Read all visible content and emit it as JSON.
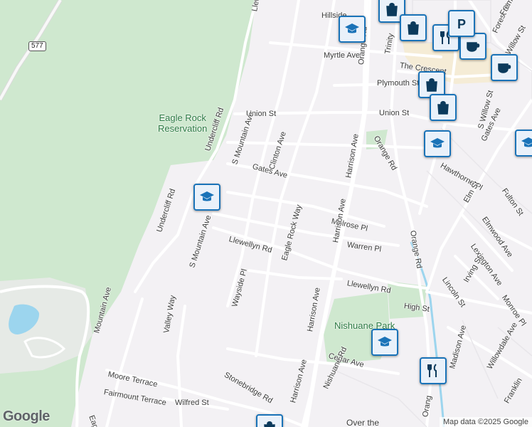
{
  "map": {
    "parks": [
      {
        "name": "Eagle Rock\nReservation"
      },
      {
        "name": "Nishuane Park"
      }
    ],
    "streets": [
      "Hillside",
      "Myrtle Ave",
      "Orange Rd",
      "The Crescent",
      "Plymouth St",
      "Union St",
      "Union St",
      "Orange Rd",
      "Clinton Ave",
      "S Mountain Ave",
      "Gates Ave",
      "Undercliff Rd",
      "Harrison Ave",
      "Hawthorne Pl",
      "Gates Ave",
      "Fulton St",
      "Elmwood Ave",
      "Elm St",
      "Melrose Pl",
      "Warren Pl",
      "Orange Rd",
      "Lexington Ave",
      "Llewellyn Rd",
      "Eagle Rock Way",
      "Harrison Ave",
      "Undercliff Rd",
      "S Mountain Ave",
      "Lincoln St",
      "Irving St",
      "Llewellyn Rd",
      "Wayside Pl",
      "Monroe Pl",
      "High St",
      "Valley Way",
      "Mountain Ave",
      "Harrison Ave",
      "Madison Ave",
      "Willowdale Ave",
      "Cedar Ave",
      "Moore Terrace",
      "Stonebridge Rd",
      "Nishuane Rd",
      "Fairmount Terrace",
      "Wilfred St",
      "Harrison Ave",
      "Eagle Ro",
      "Franklin",
      "Over the",
      "Trinity",
      "S Willow St",
      "Willow St",
      "Forest St",
      "Fremo",
      "Llew",
      "Orang"
    ],
    "route_shield": "577",
    "pins": [
      {
        "type": "school-icon"
      },
      {
        "type": "school-icon"
      },
      {
        "type": "school-icon"
      },
      {
        "type": "school-icon"
      },
      {
        "type": "shopping-bag-icon"
      },
      {
        "type": "shopping-bag-icon"
      },
      {
        "type": "shopping-bag-icon"
      },
      {
        "type": "shopping-bag-icon"
      },
      {
        "type": "restaurant-icon"
      },
      {
        "type": "restaurant-icon"
      },
      {
        "type": "cafe-icon"
      },
      {
        "type": "cafe-icon"
      },
      {
        "type": "parking-icon"
      },
      {
        "type": "school-icon"
      },
      {
        "type": "shopping-bag-icon"
      },
      {
        "type": "shopping-bag-icon"
      }
    ],
    "logo": "Google",
    "attribution": "Map data ©2025 Google",
    "colors": {
      "park": "#cfe8cf",
      "water": "#9cd5ee",
      "road": "#ffffff",
      "pin": "#1a73b8",
      "background": "#f3f1f4"
    }
  }
}
